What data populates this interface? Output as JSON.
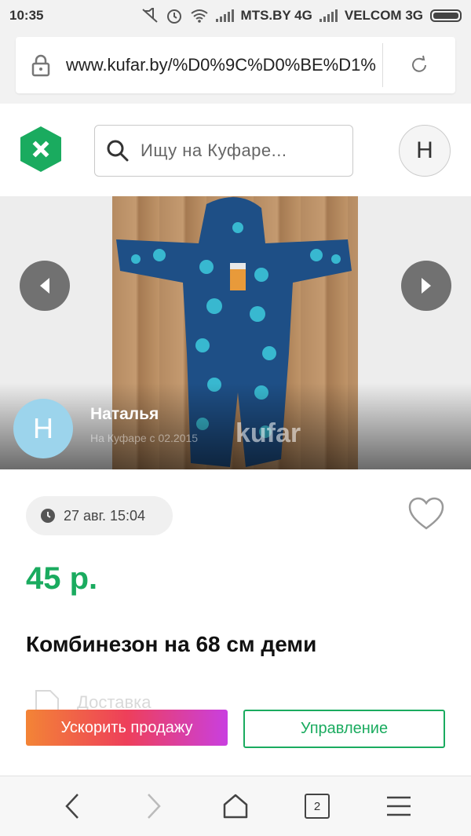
{
  "status_bar": {
    "time": "10:35",
    "carrier1": "MTS.BY 4G",
    "carrier2": "VELCOM 3G",
    "icons": [
      "mute-icon",
      "alarm-icon",
      "wifi-icon",
      "signal-icon",
      "battery-icon"
    ]
  },
  "browser": {
    "url": "www.kufar.by/%D0%9C%D0%BE%D1%",
    "tab_count": "2"
  },
  "header": {
    "search_placeholder": "Ищу на Куфаре...",
    "user_initial": "Н"
  },
  "gallery": {
    "seller_initial": "Н",
    "seller_name": "Наталья",
    "seller_since": "На Куфаре с 02.2015",
    "watermark": "kufar"
  },
  "listing": {
    "date": "27 авг. 15:04",
    "price": "45 р.",
    "title": "Комбинезон на 68 см деми",
    "delivery": "Доставка"
  },
  "actions": {
    "boost_label": "Ускорить продажу",
    "manage_label": "Управление"
  },
  "colors": {
    "accent_green": "#1aab5f",
    "boost_gradient": [
      "#f38436",
      "#ee3f5a",
      "#c93fe0"
    ],
    "seller_avatar": "#9cd4ec"
  }
}
